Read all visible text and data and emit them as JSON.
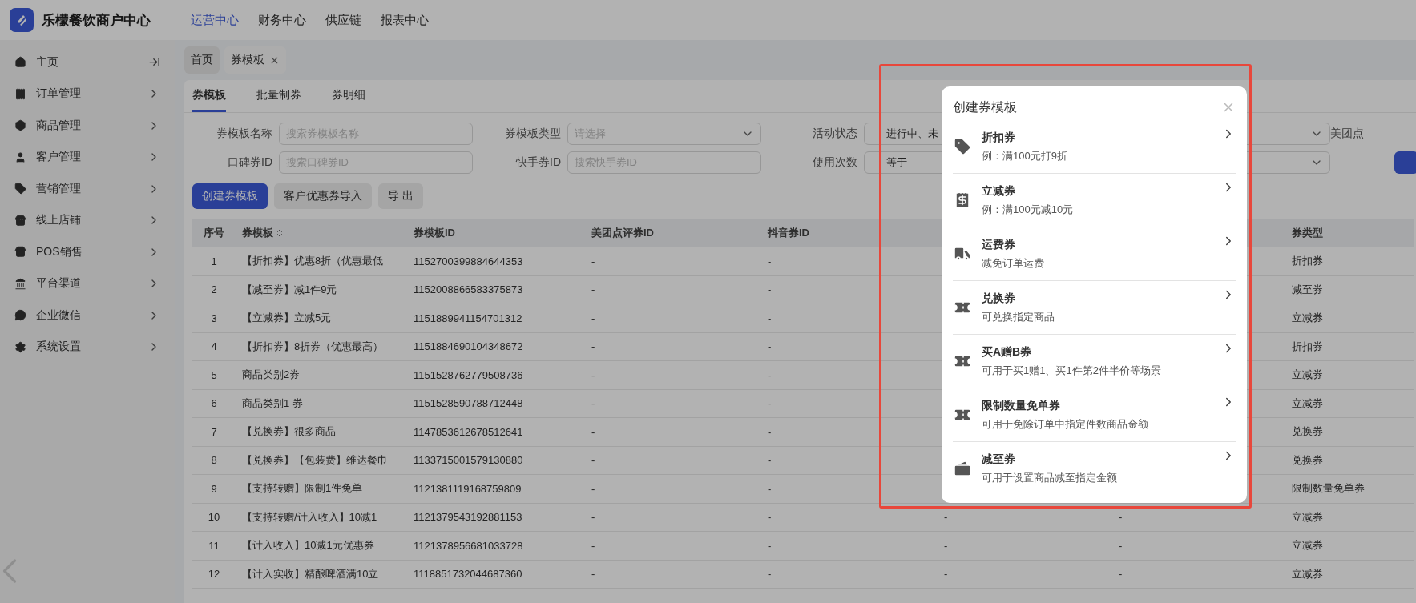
{
  "header": {
    "brand": "乐檬餐饮商户中心",
    "nav": [
      {
        "label": "运营中心",
        "selected": true
      },
      {
        "label": "财务中心",
        "selected": false
      },
      {
        "label": "供应链",
        "selected": false
      },
      {
        "label": "报表中心",
        "selected": false
      }
    ]
  },
  "sidebar": {
    "items": [
      {
        "label": "主页",
        "kind": "collapse"
      },
      {
        "label": "订单管理",
        "kind": "submenu"
      },
      {
        "label": "商品管理",
        "kind": "submenu"
      },
      {
        "label": "客户管理",
        "kind": "submenu"
      },
      {
        "label": "营销管理",
        "kind": "submenu"
      },
      {
        "label": "线上店铺",
        "kind": "submenu"
      },
      {
        "label": "POS销售",
        "kind": "submenu"
      },
      {
        "label": "平台渠道",
        "kind": "submenu"
      },
      {
        "label": "企业微信",
        "kind": "submenu"
      },
      {
        "label": "系统设置",
        "kind": "submenu"
      }
    ]
  },
  "page_tabs": [
    {
      "label": "首页",
      "selected": false,
      "closable": false
    },
    {
      "label": "券模板",
      "selected": true,
      "closable": true
    }
  ],
  "sub_tabs": [
    {
      "label": "券模板",
      "selected": true
    },
    {
      "label": "批量制券",
      "selected": false
    },
    {
      "label": "券明细",
      "selected": false
    }
  ],
  "filters": [
    {
      "label": "券模板名称",
      "kind": "input",
      "placeholder": "搜索券模板名称"
    },
    {
      "label": "券模板类型",
      "kind": "select",
      "placeholder": "请选择"
    },
    {
      "label": "活动状态",
      "kind": "select",
      "value": "进行中、未"
    },
    {
      "label": "美团点",
      "kind": "label"
    },
    {
      "label": "口碑券ID",
      "kind": "input",
      "placeholder": "搜索口碑券ID"
    },
    {
      "label": "快手券ID",
      "kind": "input",
      "placeholder": "搜索快手券ID"
    },
    {
      "label": "使用次数",
      "kind": "select",
      "value": "等于"
    },
    {
      "kind": "button"
    }
  ],
  "actions": [
    {
      "label": "创建券模板",
      "primary": true
    },
    {
      "label": "客户优惠券导入",
      "primary": false
    },
    {
      "label": "导 出",
      "primary": false
    }
  ],
  "table": {
    "columns": [
      {
        "label": "序号"
      },
      {
        "label": "券模板",
        "sortable": true
      },
      {
        "label": "券模板ID"
      },
      {
        "label": "美团点评券ID"
      },
      {
        "label": "抖音券ID"
      },
      {},
      {},
      {
        "label": "券类型"
      }
    ],
    "rows": [
      [
        "1",
        "【折扣券】优惠8折（优惠最低",
        "1152700399884644353",
        "-",
        "-",
        null,
        null,
        "折扣券"
      ],
      [
        "2",
        "【减至券】减1件9元",
        "1152008866583375873",
        "-",
        "-",
        null,
        null,
        "减至券"
      ],
      [
        "3",
        "【立减券】立减5元",
        "1151889941154701312",
        "-",
        "-",
        null,
        null,
        "立减券"
      ],
      [
        "4",
        "【折扣券】8折券（优惠最高）",
        "1151884690104348672",
        "-",
        "-",
        null,
        null,
        "折扣券"
      ],
      [
        "5",
        "商品类别2券",
        "1151528762779508736",
        "-",
        "-",
        null,
        null,
        "立减券"
      ],
      [
        "6",
        "商品类别1 券",
        "1151528590788712448",
        "-",
        "-",
        null,
        null,
        "立减券"
      ],
      [
        "7",
        "【兑换券】很多商品",
        "1147853612678512641",
        "-",
        "-",
        null,
        null,
        "兑换券"
      ],
      [
        "8",
        "【兑换券】【包装费】维达餐巾",
        "1133715001579130880",
        "-",
        "-",
        null,
        null,
        "兑换券"
      ],
      [
        "9",
        "【支持转赠】限制1件免单",
        "1121381119168759809",
        "-",
        "-",
        null,
        null,
        "限制数量免单券"
      ],
      [
        "10",
        "【支持转赠/计入收入】10减1",
        "1121379543192881153",
        "-",
        "-",
        "-",
        "-",
        "立减券"
      ],
      [
        "11",
        "【计入收入】10减1元优惠券",
        "1121378956681033728",
        "-",
        "-",
        "-",
        "-",
        "立减券"
      ],
      [
        "12",
        "【计入实收】精酿啤酒满10立",
        "1118851732044687360",
        "-",
        "-",
        "-",
        "-",
        "立减券"
      ]
    ]
  },
  "modal": {
    "title": "创建券模板",
    "items": [
      {
        "title": "折扣券",
        "description": "例：满100元打9折"
      },
      {
        "title": "立减券",
        "description": "例：满100元减10元"
      },
      {
        "title": "运费券",
        "description": "减免订单运费"
      },
      {
        "title": "兑换券",
        "description": "可兑换指定商品"
      },
      {
        "title": "买A赠B券",
        "description": "可用于买1赠1、买1件第2件半价等场景"
      },
      {
        "title": "限制数量免单券",
        "description": "可用于免除订单中指定件数商品金额"
      },
      {
        "title": "减至券",
        "description": "可用于设置商品减至指定金额"
      }
    ]
  }
}
